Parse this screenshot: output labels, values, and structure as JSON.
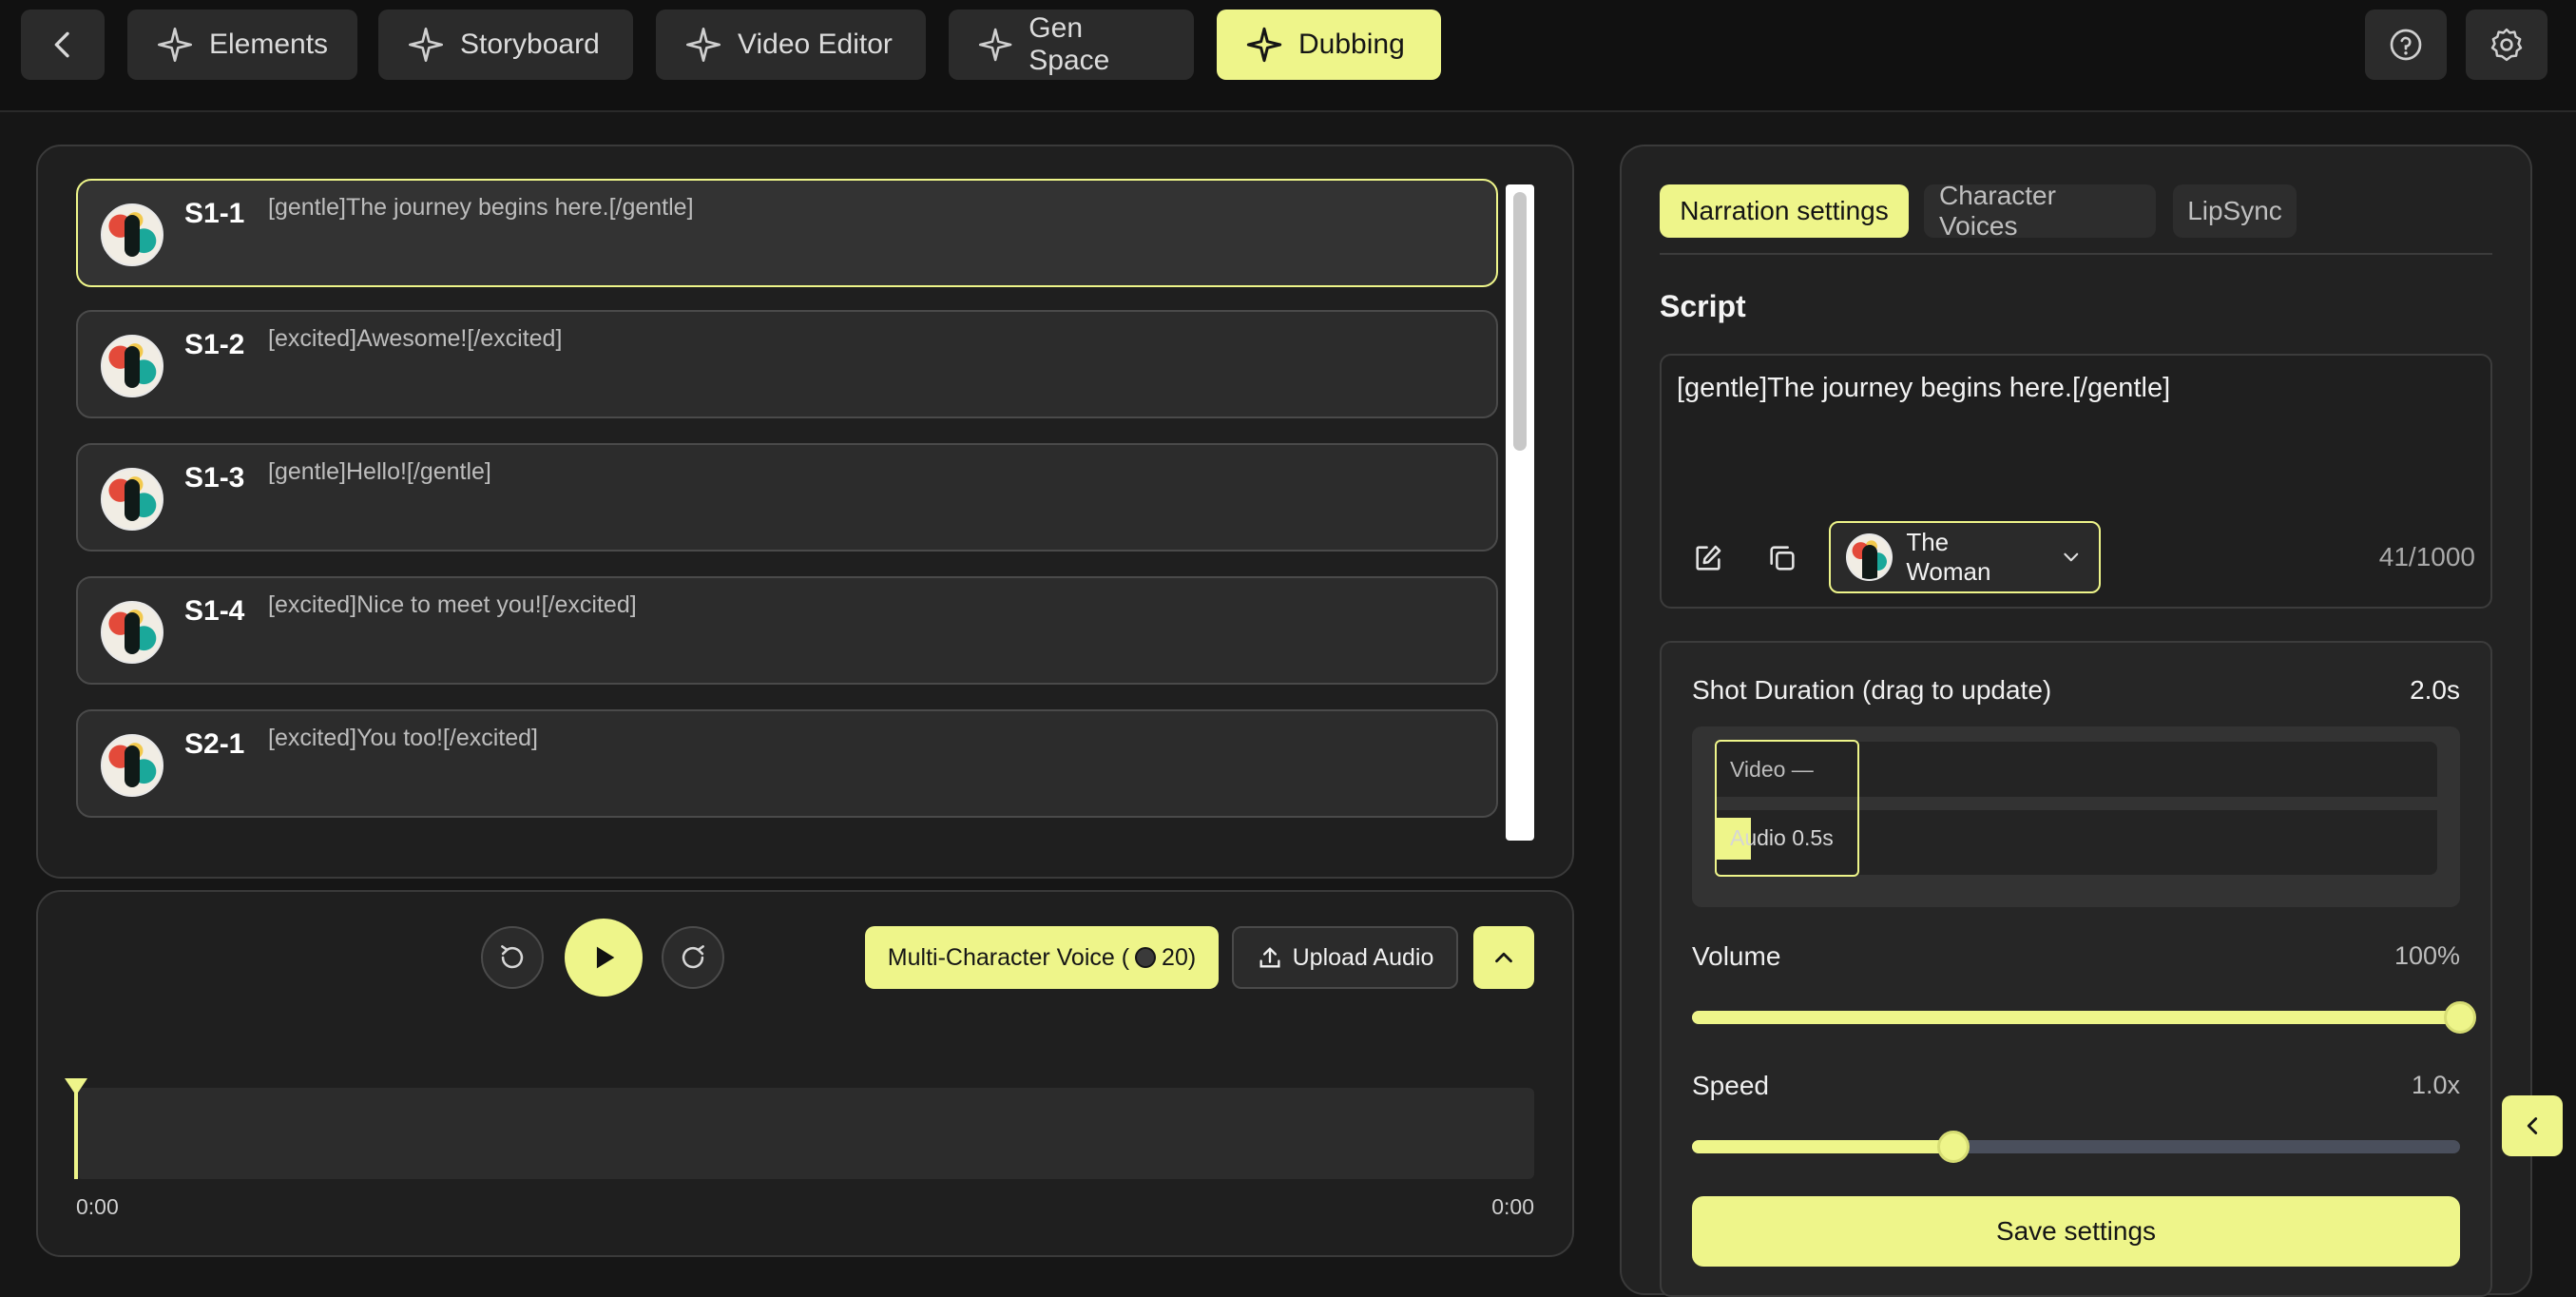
{
  "nav": {
    "back_icon": "chevron-left-icon",
    "tabs": [
      {
        "label": "Elements",
        "icon": "sparkle-icon",
        "active": false
      },
      {
        "label": "Storyboard",
        "icon": "sparkle-icon",
        "active": false
      },
      {
        "label": "Video Editor",
        "icon": "sparkle-icon",
        "active": false
      },
      {
        "label": "Gen Space",
        "icon": "sparkle-icon",
        "active": false
      },
      {
        "label": "Dubbing",
        "icon": "sparkle-icon",
        "active": true
      }
    ],
    "right_icons": [
      "help-icon",
      "settings-icon"
    ]
  },
  "shots": [
    {
      "code": "S1-1",
      "text": "[gentle]The journey begins here.[/gentle]",
      "active": true
    },
    {
      "code": "S1-2",
      "text": "[excited]Awesome![/excited]",
      "active": false
    },
    {
      "code": "S1-3",
      "text": "[gentle]Hello![/gentle]",
      "active": false
    },
    {
      "code": "S1-4",
      "text": "[excited]Nice to meet you![/excited]",
      "active": false
    },
    {
      "code": "S2-1",
      "text": "[excited]You too![/excited]",
      "active": false
    }
  ],
  "player": {
    "multi_voice_label": "Multi-Character Voice (",
    "multi_voice_cost": "20)",
    "upload_label": "Upload Audio",
    "time_start": "0:00",
    "time_end": "0:00"
  },
  "settings": {
    "tabs": [
      "Narration settings",
      "Character Voices",
      "LipSync"
    ],
    "active_tab": "Narration settings",
    "script_title": "Script",
    "script_text": "[gentle]The journey begins here.[/gentle]",
    "voice_name": "The Woman",
    "char_count": "41/1000",
    "shot_duration_label": "Shot Duration (drag to update)",
    "shot_duration_value": "2.0s",
    "video_track_label": "Video —",
    "audio_track_label": "Audio 0.5s",
    "volume_label": "Volume",
    "volume_value": "100%",
    "volume_level": 1.0,
    "speed_label": "Speed",
    "speed_value": "1.0x",
    "speed_level": 0.34,
    "save_label": "Save settings"
  },
  "colors": {
    "accent": "#eef58a",
    "background": "#161616",
    "panel": "#1f1f1f"
  }
}
